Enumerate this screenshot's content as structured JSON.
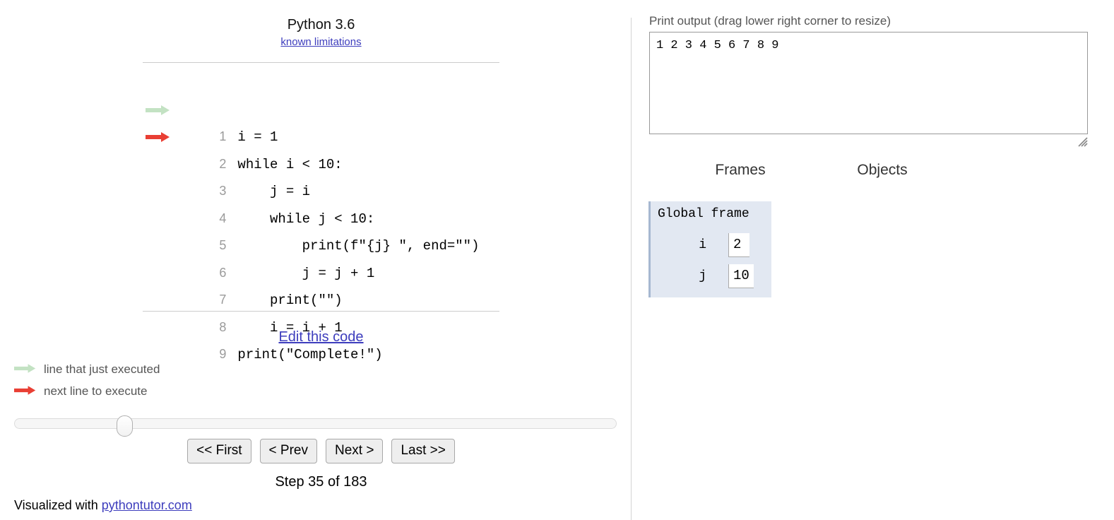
{
  "left_pane": {
    "python_version": "Python 3.6",
    "known_limitations_link": "known limitations",
    "edit_code_link": "Edit this code",
    "code_lines": [
      {
        "number": "1",
        "text": "i = 1",
        "arrow": "none"
      },
      {
        "number": "2",
        "text": "while i < 10:",
        "arrow": "just-executed"
      },
      {
        "number": "3",
        "text": "    j = i",
        "arrow": "next-to-execute"
      },
      {
        "number": "4",
        "text": "    while j < 10:",
        "arrow": "none"
      },
      {
        "number": "5",
        "text": "        print(f\"{j} \", end=\"\")",
        "arrow": "none"
      },
      {
        "number": "6",
        "text": "        j = j + 1",
        "arrow": "none"
      },
      {
        "number": "7",
        "text": "    print(\"\")",
        "arrow": "none"
      },
      {
        "number": "8",
        "text": "    i = i + 1",
        "arrow": "none"
      },
      {
        "number": "9",
        "text": "print(\"Complete!\")",
        "arrow": "none"
      }
    ],
    "legend": {
      "just_executed": "line that just executed",
      "next_to_execute": "next line to execute"
    },
    "slider": {
      "value": "35",
      "min": "1",
      "max": "183"
    },
    "nav": {
      "first": "<< First",
      "prev": "< Prev",
      "next": "Next >",
      "last": "Last >>"
    },
    "step_counter": "Step 35 of 183",
    "footer": {
      "prefix": "Visualized with ",
      "link": "pythontutor.com"
    }
  },
  "right_pane": {
    "print_output_label": "Print output (drag lower right corner to resize)",
    "print_output_text": "1 2 3 4 5 6 7 8 9",
    "frames_heading": "Frames",
    "objects_heading": "Objects",
    "global_frame": {
      "title": "Global frame",
      "variables": [
        {
          "name": "i",
          "value": "2"
        },
        {
          "name": "j",
          "value": "10"
        }
      ]
    }
  },
  "colors": {
    "just_executed_arrow": "#c3e2c3",
    "next_arrow": "#e93f34",
    "link": "#3d3dbd",
    "frame_background": "#e2e8f2",
    "frame_border": "#a6b8d1",
    "line_number": "#9a9a9a"
  }
}
